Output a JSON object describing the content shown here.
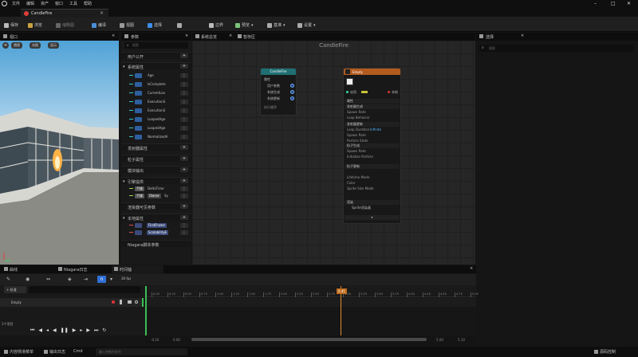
{
  "menu": {
    "items": [
      "文件",
      "编辑",
      "资产",
      "窗口",
      "工具",
      "帮助"
    ]
  },
  "tab": {
    "title": "CandleFire"
  },
  "toolbar": {
    "save": "保存",
    "browse": "浏览",
    "thumbnail": "缩略图",
    "compile": "编译",
    "find": "视图",
    "apply": "选择",
    "bounds": "边界",
    "preview": "预览",
    "baseline": "基准",
    "perf": "性能",
    "settings": "设置"
  },
  "viewport": {
    "title": "视口",
    "btn_perspective": "透视",
    "btn_lit": "光照",
    "btn_show": "显示"
  },
  "params": {
    "title": "参数",
    "search_placeholder": "搜索",
    "sections": [
      {
        "label": "用户公开"
      },
      {
        "label": "系统属性"
      },
      {
        "label": "发射器属性"
      },
      {
        "label": "粒子属性"
      },
      {
        "label": "模块输出"
      },
      {
        "label": "引擎提供"
      },
      {
        "label": "渲染器可见参数"
      },
      {
        "label": "本地属性"
      },
      {
        "label": "Niagara脚本参数"
      }
    ],
    "system_rows": [
      "Age",
      "IsComplete",
      "CurrentLoo",
      "ExecutionS",
      "ExecutionS",
      "LoopedAge",
      "LoopedAge",
      "NormalizedA"
    ],
    "engine_rows": [
      {
        "type": "个体",
        "name": "DeltaTime"
      },
      {
        "type": "个体",
        "name": "Owner",
        "suffix": "Sy"
      }
    ],
    "local_rows": [
      "FirstFrame",
      "ScalabilityE"
    ]
  },
  "graph": {
    "tab_title": "系统总览",
    "tab2": "暂存区",
    "title": "CandleFire",
    "system_node": {
      "title": "CandleFire",
      "rows": [
        "属性",
        "用户参数",
        "系统生成",
        "系统更新"
      ],
      "footer": "执行顺序"
    },
    "emitter_node": {
      "title": "Empty",
      "rows": [
        "属性",
        "发射器生成",
        "发射器更新",
        "粒子生成",
        "粒子更新",
        "渲染"
      ],
      "enable_label": "启用",
      "local_label": "本地",
      "sub_rows": [
        "Spawn Rate",
        "Loop Behavior",
        "Loop Duration",
        "Spawn Rate",
        "Particle State",
        "Spawn Rate",
        "Initialize Particle",
        "Lifetime Mode",
        "Color",
        "Sprite Size Mode"
      ],
      "spawn_state": "Infinite",
      "renderer": "Sprite渲染器"
    }
  },
  "details": {
    "title": "选择",
    "search_placeholder": "搜索"
  },
  "timeline": {
    "tabs": [
      "曲线",
      "Niagara日志",
      "时间轴"
    ],
    "add_track": "+ 轨道",
    "fps": "30 fps",
    "track": "Empty",
    "current_time": "0.41",
    "range_start": "-0.10",
    "range_start2": "0.00",
    "range_end": "5.00",
    "range_end2": "5.10",
    "ticks": [
      "0.00",
      "0.25",
      "0.50",
      "0.75",
      "1.00",
      "1.25",
      "1.50",
      "1.75",
      "2.00",
      "2.25",
      "2.50",
      "2.75",
      "3.00",
      "3.25",
      "3.50",
      "3.75",
      "4.00",
      "4.25",
      "4.50",
      "4.75",
      "5.00"
    ],
    "items_count": "1个项目"
  },
  "status": {
    "drawer": "内容侧滑菜单",
    "log": "输出日志",
    "cmd": "Cmd",
    "cmd_placeholder": "输入控制台命令",
    "source": "源码控制"
  }
}
